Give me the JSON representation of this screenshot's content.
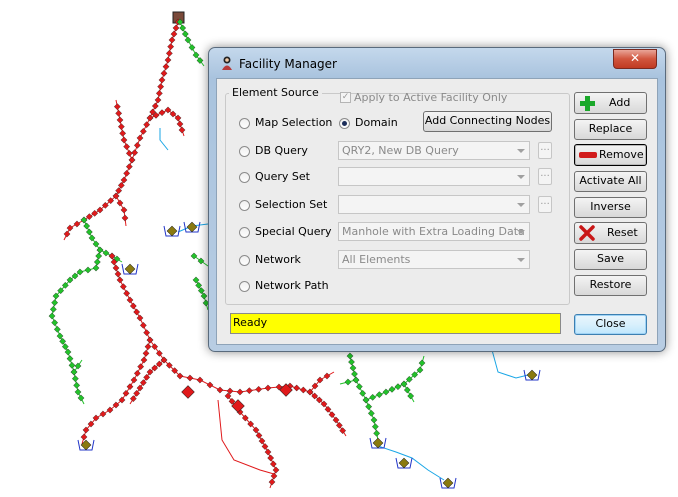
{
  "window": {
    "title": "Facility Manager",
    "close_symbol": "✕",
    "icon": "facility-manager-icon"
  },
  "element_source": {
    "legend": "Element Source",
    "apply_active_label": "Apply to Active Facility Only",
    "apply_active_checked": true,
    "options": [
      {
        "label": "Map Selection",
        "selected": false
      },
      {
        "label": "DB Query",
        "selected": false
      },
      {
        "label": "Query Set",
        "selected": false
      },
      {
        "label": "Selection Set",
        "selected": false
      },
      {
        "label": "Special Query",
        "selected": false
      },
      {
        "label": "Network",
        "selected": false
      },
      {
        "label": "Network Path",
        "selected": false
      }
    ],
    "domain_label": "Domain",
    "domain_selected": true,
    "add_connecting_nodes_label": "Add Connecting Nodes",
    "db_query_value": "QRY2, New DB Query",
    "query_set_value": "",
    "selection_set_value": "",
    "special_query_value": "Manhole with Extra Loading Data",
    "network_value": "All Elements",
    "browse_label": "..."
  },
  "status": {
    "text": "Ready"
  },
  "actions": {
    "add": "Add",
    "replace": "Replace",
    "remove": "Remove",
    "activate_all": "Activate All",
    "inverse": "Inverse",
    "reset": "Reset",
    "save": "Save",
    "restore": "Restore",
    "close": "Close"
  },
  "colors": {
    "status_bg": "#ffff00",
    "red_nodes": "#e0191b",
    "green_nodes": "#22c22a",
    "pipe_blue": "#1aa6e6",
    "manhole": "#8a7a10"
  }
}
